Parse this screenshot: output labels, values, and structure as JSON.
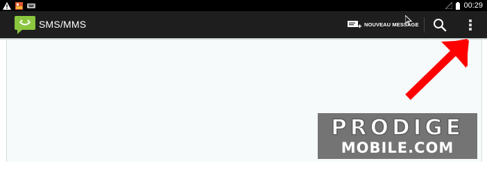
{
  "status_bar": {
    "time": "00:29",
    "icons": [
      "warning-icon",
      "notification-app-icon",
      "keyboard-icon",
      "signal-icon",
      "battery-icon"
    ]
  },
  "action_bar": {
    "app_icon": "sms-bubble-icon",
    "title": "SMS/MMS",
    "new_message_label": "NOUVEAU MESSAGE",
    "search_icon": "search-icon",
    "overflow_icon": "overflow-menu-icon"
  },
  "watermark": {
    "line1": "PRODIGE",
    "line2": "MOBILE.COM"
  },
  "annotation": {
    "arrow_color": "#ff0000",
    "points_to": "overflow-menu-icon"
  },
  "colors": {
    "app_bar": "#1e1e1e",
    "status_bar": "#000000",
    "content_bg": "#f6fafa",
    "app_icon_green": "#8bc63f"
  }
}
